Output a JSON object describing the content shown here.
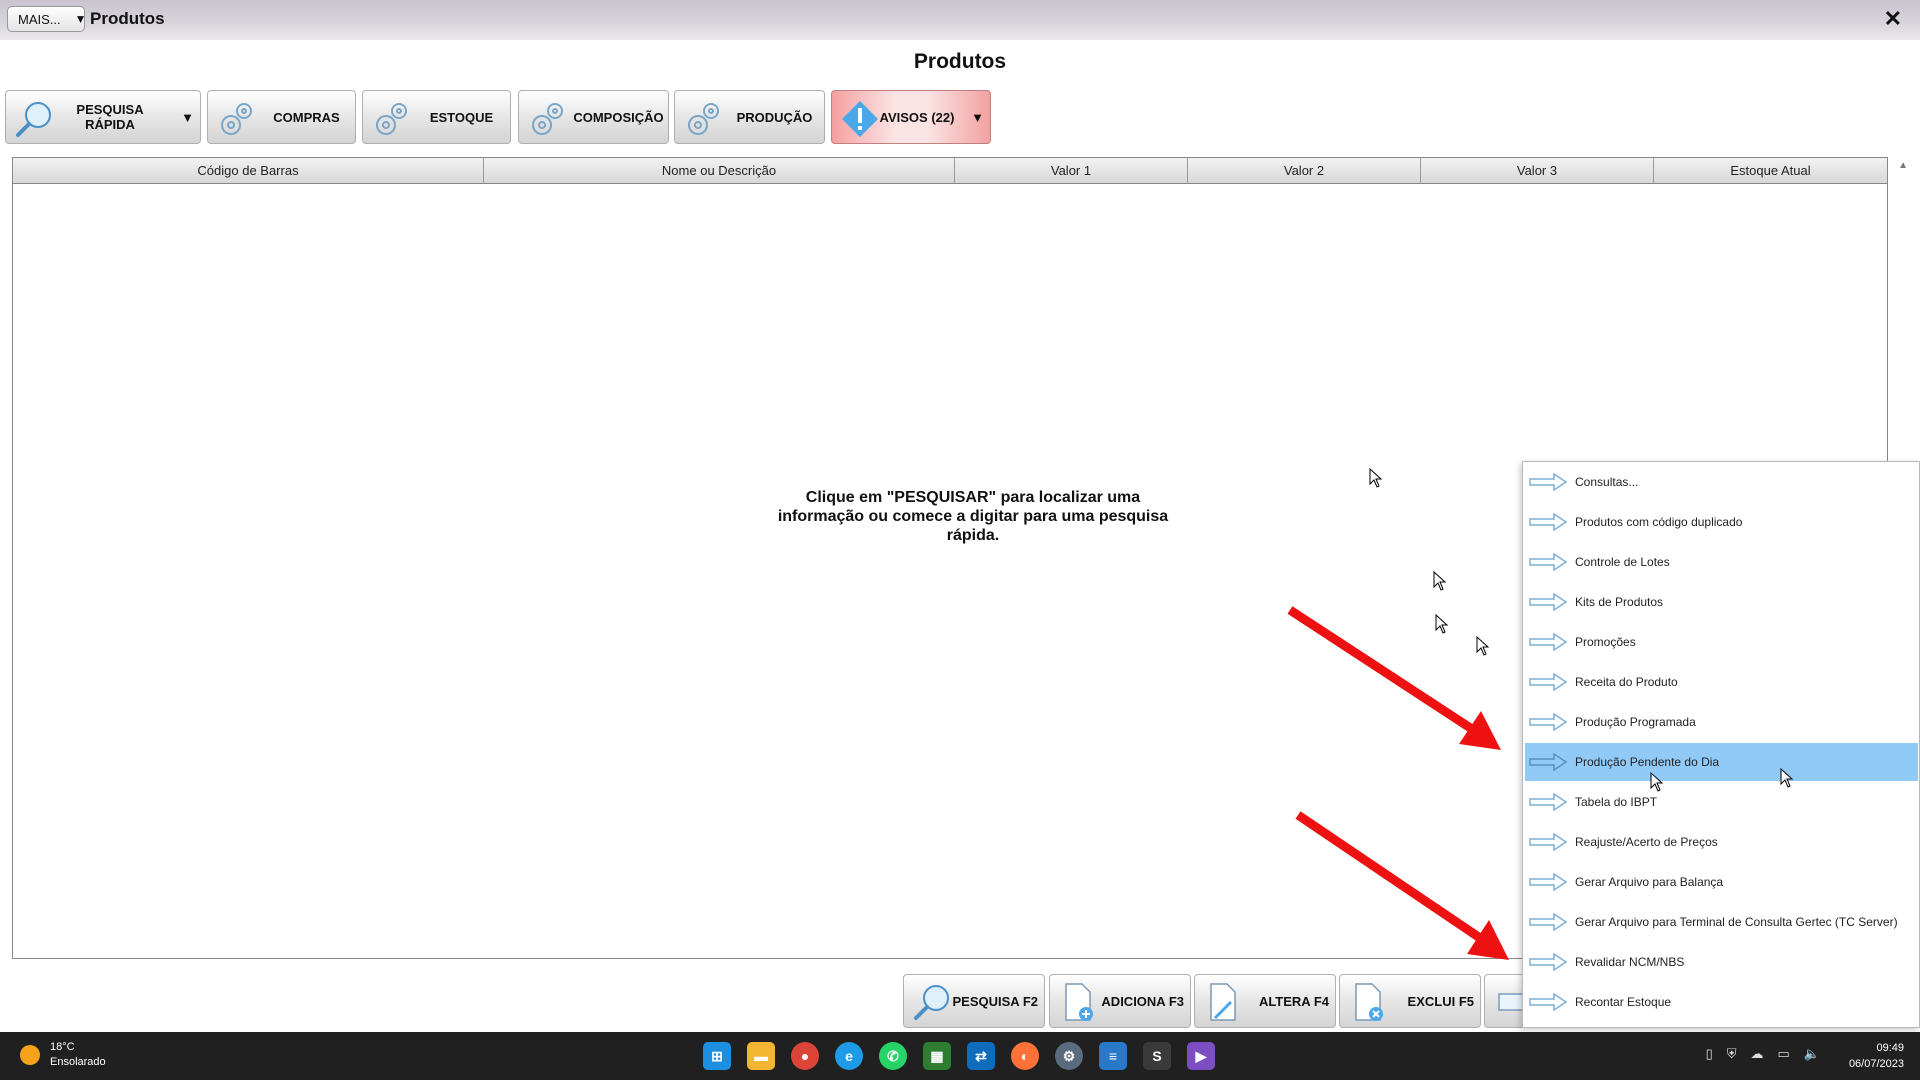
{
  "window": {
    "menu_button": "MAIS...",
    "title": "Produtos",
    "close": "✕"
  },
  "page": {
    "heading": "Produtos"
  },
  "toolbar": {
    "quick_search": "PESQUISA RÁPIDA",
    "purchases": "COMPRAS",
    "stock": "ESTOQUE",
    "composition": "COMPOSIÇÃO",
    "production": "PRODUÇÃO",
    "warnings": "AVISOS (22)"
  },
  "grid": {
    "columns": [
      "Código de Barras",
      "Nome ou Descrição",
      "Valor 1",
      "Valor 2",
      "Valor 3",
      "Estoque Atual"
    ],
    "empty_message": "Clique em \"PESQUISAR\" para localizar uma informação ou comece a digitar para uma pesquisa rápida."
  },
  "bottom_toolbar": {
    "search": "PESQUISA F2",
    "add": "ADICIONA F3",
    "edit": "ALTERA F4",
    "delete": "EXCLUI F5"
  },
  "context_menu": {
    "items": [
      "Consultas...",
      "Produtos com código duplicado",
      "Controle de Lotes",
      "Kits de Produtos",
      "Promoções",
      "Receita do Produto",
      "Produção Programada",
      "Produção Pendente do Dia",
      "Tabela do IBPT",
      "Reajuste/Acerto de Preços",
      "Gerar Arquivo para Balança",
      "Gerar Arquivo para Terminal de Consulta Gertec (TC Server)",
      "Revalidar NCM/NBS",
      "Recontar Estoque"
    ],
    "highlighted": "Produção Pendente do Dia",
    "highlight_color": "#91c9f7"
  },
  "taskbar": {
    "temperature": "18°C",
    "weather": "Ensolarado",
    "time": "09:49",
    "date": "06/07/2023"
  },
  "colors": {
    "annotation_arrow": "#ee1111",
    "warning_button": "#f4a0a0",
    "info_icon": "#4aa8e8"
  }
}
